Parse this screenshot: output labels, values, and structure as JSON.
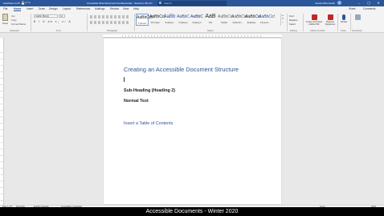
{
  "titlebar": {
    "autosave": "AutoSave ● Off",
    "document_title": "Accessible Word Document Fundamentals  -  Saved to this PC",
    "search_placeholder": "Search",
    "user": "Joanne Brennecke",
    "min": "–",
    "max": "▢",
    "close": "✕"
  },
  "tabs": [
    "File",
    "Home",
    "Insert",
    "Draw",
    "Design",
    "Layout",
    "References",
    "Mailings",
    "Review",
    "View",
    "Help"
  ],
  "tabs_active": "Home",
  "tab_actions": {
    "share": "Share",
    "comments": "Comments"
  },
  "ribbon": {
    "clipboard": {
      "paste": "Paste",
      "cut": "Cut",
      "copy": "Copy",
      "format_painter": "Format Painter",
      "label": "Clipboard"
    },
    "font": {
      "family": "Calibri (Body)",
      "size": "11",
      "formatting": "B I U ab x₂ x²  A",
      "label": "Font"
    },
    "paragraph": {
      "label": "Paragraph"
    },
    "styles": {
      "label": "Styles",
      "items": [
        {
          "sample": "AaBbCcI",
          "name": "¶ Normal"
        },
        {
          "sample": "AaBbCcI",
          "name": "¶ No Spac..."
        },
        {
          "sample": "AaBb",
          "name": "Heading 1"
        },
        {
          "sample": "AaBbC",
          "name": "Heading 2"
        },
        {
          "sample": "AaBbC",
          "name": "Heading 3"
        },
        {
          "sample": "AaB",
          "name": "Title"
        },
        {
          "sample": "AaBbCcI",
          "name": "Subtitle"
        },
        {
          "sample": "AaBbCcI",
          "name": "Subtle Em..."
        },
        {
          "sample": "AaBbCcI",
          "name": "Emphasis"
        },
        {
          "sample": "AaBbCcI",
          "name": "Intense E..."
        }
      ]
    },
    "editing": {
      "find": "Find",
      "replace": "Replace",
      "select": "Select",
      "label": "Editing"
    },
    "adobe": {
      "create": "Create and Share Adobe PDF",
      "request": "Request Signatures",
      "label": "Adobe Acrobat"
    },
    "voice": {
      "dictate": "Dictate",
      "label": "Voice"
    },
    "sensitivity": {
      "label": "Sensitivity"
    }
  },
  "document": {
    "heading1": "Creating an Accessible Document Structure",
    "heading2": "Sub-Heading (Heading 2)",
    "normal": "Normal Text",
    "toc": "Insert a Table of Contents"
  },
  "status": {
    "page": "Page 1 of 4",
    "words": "118 words",
    "language": "English (Canada)",
    "accessibility": "Accessibility: Investigate",
    "focus": "Focus",
    "zoom": "110%"
  },
  "caption": "Accessible Documents - Winter 2020",
  "colors": {
    "word_blue": "#2b579a",
    "heading_blue": "#2f5496"
  }
}
